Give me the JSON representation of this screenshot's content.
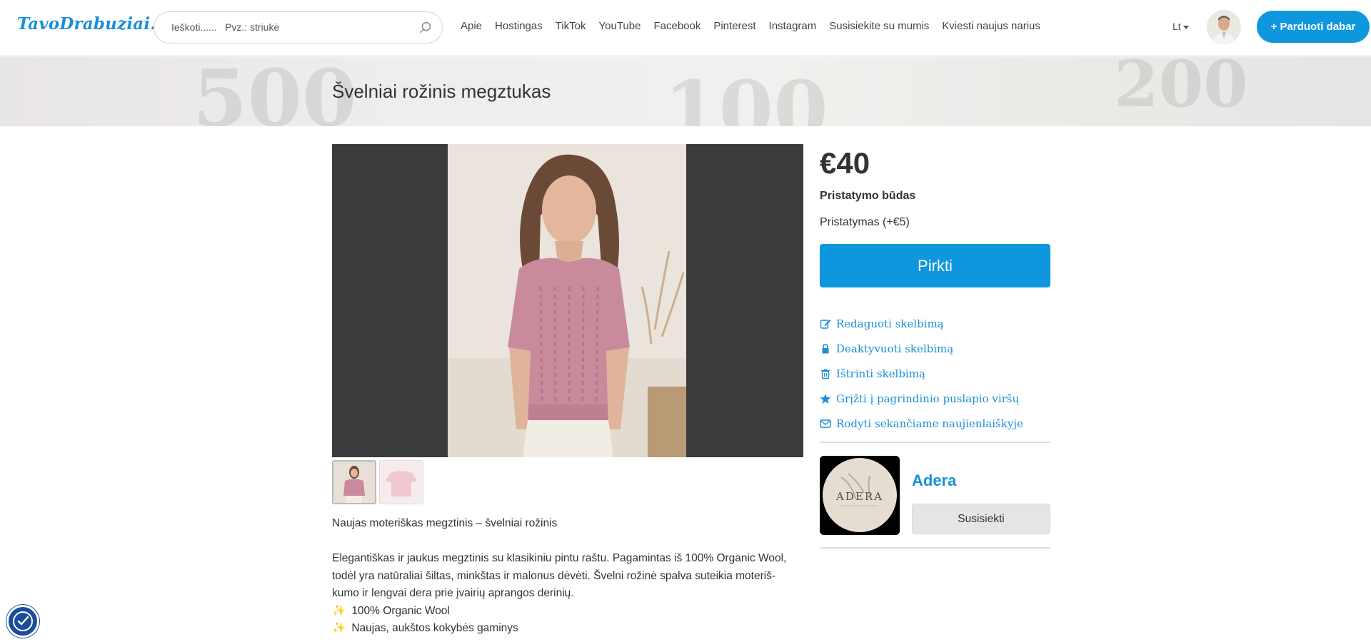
{
  "header": {
    "logo": "TavoDrabuziai.lt",
    "search": {
      "placeholder": "Ieškoti......",
      "hint": "Pvz.: striukė"
    },
    "nav": [
      "Apie",
      "Hostingas",
      "TikTok",
      "YouTube",
      "Facebook",
      "Pinterest",
      "Instagram",
      "Susisiekite su mumis",
      "Kviesti naujus narius"
    ],
    "language": "Lt",
    "sell_button": "+ Parduoti dabar"
  },
  "page": {
    "title": "Švelniai rožinis megztukas"
  },
  "listing": {
    "price": "€40",
    "shipping_title": "Pristatymo būdas",
    "shipping_option": "Pristatymas (+€5)",
    "buy_button": "Pirkti",
    "actions": [
      {
        "label": "Redaguoti skelbimą",
        "icon": "edit-icon"
      },
      {
        "label": "Deaktyvuoti skelbimą",
        "icon": "lock-icon"
      },
      {
        "label": "Ištrinti skelbimą",
        "icon": "trash-icon"
      },
      {
        "label": "Grįžti į pagrindinio puslapio viršų",
        "icon": "star-icon"
      },
      {
        "label": "Rodyti sekančiame naujienlaiškyje",
        "icon": "envelope-icon"
      }
    ]
  },
  "seller": {
    "name": "Adera",
    "logo_text": "ADERA",
    "contact_button": "Susisiekti"
  },
  "description": {
    "heading": "Naujas moteriškas megztinis – švelniai rožinis",
    "paragraph_lines": [
      "Elegantiškas ir jaukus megztinis su klasikiniu pintu raštu. Pagamintas iš 100% Organic Wool,",
      "todėl yra natūraliai šiltas, minkštas ir malonus dėvėti. Švelni rožinė spalva suteikia moteriš-",
      "kumo ir lengvai dera prie įvairių aprangos derinių."
    ],
    "bullets": [
      "100% Organic Wool",
      "Naujas, aukštos kokybės gaminys"
    ]
  },
  "colors": {
    "accent": "#0f97dd",
    "link": "#1a8fd8",
    "dark_bg": "#3b3b3b"
  }
}
